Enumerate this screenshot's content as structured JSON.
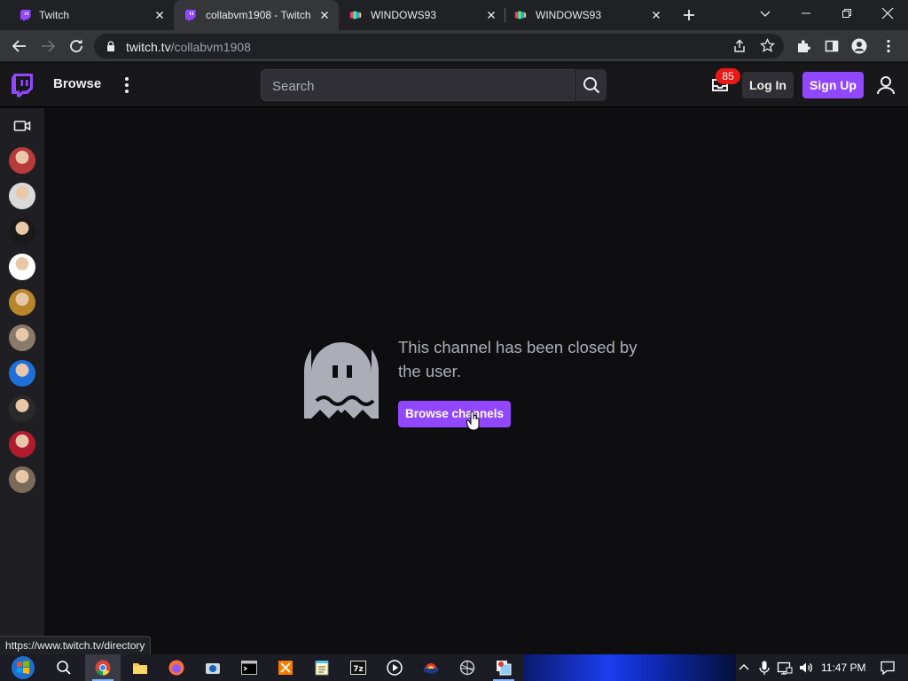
{
  "browser": {
    "tabs": [
      {
        "title": "Twitch",
        "icon": "twitch-favicon"
      },
      {
        "title": "collabvm1908 - Twitch",
        "icon": "twitch-favicon",
        "active": true
      },
      {
        "title": "WINDOWS93",
        "icon": "windows93-favicon"
      },
      {
        "title": "WINDOWS93",
        "icon": "windows93-favicon"
      }
    ],
    "url_host": "twitch.tv",
    "url_path": "/collabvm1908",
    "status_url": "https://www.twitch.tv/directory"
  },
  "nav": {
    "browse_label": "Browse",
    "search_placeholder": "Search",
    "notification_count": "85",
    "login_label": "Log In",
    "signup_label": "Sign Up"
  },
  "sidebar": {
    "avatars": [
      {
        "name": "followed-channel-1",
        "color": "#b83a3a"
      },
      {
        "name": "followed-channel-2",
        "color": "#d9d9d9"
      },
      {
        "name": "followed-channel-3",
        "color": "#1a1a1a"
      },
      {
        "name": "followed-channel-4",
        "color": "#ffffff"
      },
      {
        "name": "followed-channel-5",
        "color": "#b8862a"
      },
      {
        "name": "followed-channel-6",
        "color": "#8a7a6a"
      },
      {
        "name": "followed-channel-7",
        "color": "#1e6fd9"
      },
      {
        "name": "followed-channel-8",
        "color": "#2a2a2a"
      },
      {
        "name": "followed-channel-9",
        "color": "#b01c2e"
      },
      {
        "name": "followed-channel-10",
        "color": "#7a6a5a"
      }
    ]
  },
  "main": {
    "message": "This channel has been closed by the user.",
    "button_label": "Browse channels"
  },
  "taskbar": {
    "time": "11:47 PM"
  },
  "colors": {
    "accent": "#9147ff",
    "badge": "#e91916",
    "background": "#0e0e10"
  }
}
